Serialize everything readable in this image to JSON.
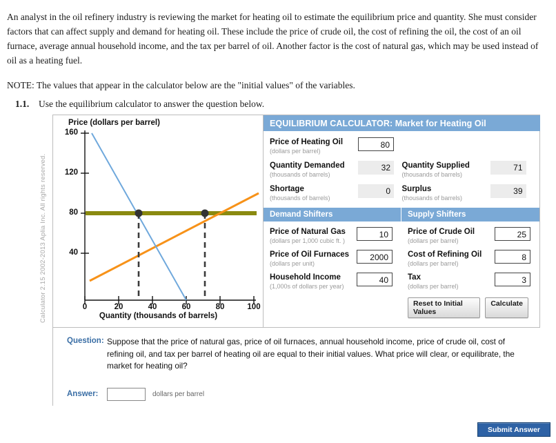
{
  "intro": {
    "paragraph": "An analyst in the oil refinery industry is reviewing the market for heating oil to estimate the equilibrium price and quantity. She must consider factors that can affect supply and demand for heating oil. These include the price of crude oil, the cost of refining the oil, the cost of an oil furnace, average annual household income, and the tax per barrel of oil. Another factor is the cost of natural gas, which may be used instead of oil as a heating fuel.",
    "note": "NOTE: The values that appear in the calculator below are the \"initial values\" of the variables.",
    "question_number": "1.1.",
    "question_instruction": "Use the equilibrium calculator to answer the question below."
  },
  "copyright": "Calculator 2.15  2002-2013 Aplia Inc. All rights reserved.",
  "calculator": {
    "title": "EQUILIBRIUM CALCULATOR: Market for Heating Oil",
    "fields": {
      "price": {
        "label": "Price of Heating Oil",
        "sub": "(dollars per barrel)",
        "value": "80"
      },
      "qd": {
        "label": "Quantity Demanded",
        "sub": "(thousands of barrels)",
        "value": "32"
      },
      "qs": {
        "label": "Quantity Supplied",
        "sub": "(thousands of barrels)",
        "value": "71"
      },
      "shortage": {
        "label": "Shortage",
        "sub": "(thousands of barrels)",
        "value": "0"
      },
      "surplus": {
        "label": "Surplus",
        "sub": "(thousands of barrels)",
        "value": "39"
      }
    },
    "demand_shifters": {
      "header": "Demand Shifters",
      "items": [
        {
          "label": "Price of Natural Gas",
          "sub": "(dollars per 1,000 cubic ft. )",
          "value": "10"
        },
        {
          "label": "Price of Oil Furnaces",
          "sub": "(dollars per unit)",
          "value": "2000"
        },
        {
          "label": "Household Income",
          "sub": "(1,000s of dollars per year)",
          "value": "40"
        }
      ]
    },
    "supply_shifters": {
      "header": "Supply Shifters",
      "items": [
        {
          "label": "Price of Crude Oil",
          "sub": "(dollars per barrel)",
          "value": "25"
        },
        {
          "label": "Cost of Refining Oil",
          "sub": "(dollars per barrel)",
          "value": "8"
        },
        {
          "label": "Tax",
          "sub": "(dollars per barrel)",
          "value": "3"
        }
      ]
    },
    "buttons": {
      "reset": "Reset to Initial Values",
      "calculate": "Calculate"
    }
  },
  "question": {
    "label": "Question:",
    "text": "Suppose that the price of natural gas, price of oil furnaces, annual household income, price of crude oil, cost of refining oil, and tax per barrel of heating oil are equal to their initial values. What price will clear, or equilibrate, the market for heating oil?",
    "answer_label": "Answer:",
    "answer_value": "",
    "answer_unit": "dollars per barrel"
  },
  "submit": {
    "label": "Submit Answer"
  },
  "colors": {
    "header_blue": "#7aa9d6",
    "demand_line": "#6fa8dc",
    "supply_line": "#f79219",
    "price_line": "#8a8a10",
    "question_blue": "#3a6ea5",
    "submit_blue": "#2e62a5"
  },
  "chart_data": {
    "type": "line",
    "title": "",
    "xlabel": "Quantity (thousands of barrels)",
    "ylabel": "Price (dollars per barrel)",
    "xlim": [
      0,
      105
    ],
    "ylim": [
      0,
      170
    ],
    "xticks": [
      0,
      20,
      40,
      60,
      80,
      100
    ],
    "yticks": [
      40,
      80,
      120,
      160
    ],
    "grid": false,
    "legend": "none",
    "series": [
      {
        "name": "Demand",
        "color": "#6fa8dc",
        "x": [
          4,
          60
        ],
        "y": [
          168,
          0
        ]
      },
      {
        "name": "Supply",
        "color": "#f79219",
        "x": [
          3,
          103
        ],
        "y": [
          19,
          107
        ]
      },
      {
        "name": "Price Line",
        "color": "#8a8a10",
        "x": [
          0,
          105
        ],
        "y": [
          80,
          80
        ]
      }
    ],
    "markers": [
      {
        "label": "Quantity Demanded at P=80",
        "x": 32,
        "y": 80
      },
      {
        "label": "Quantity Supplied at P=80",
        "x": 71,
        "y": 80
      }
    ],
    "dashed_drops": [
      {
        "x": 32,
        "y_from": 80,
        "y_to": 0
      },
      {
        "x": 71,
        "y_from": 80,
        "y_to": 0
      }
    ]
  }
}
